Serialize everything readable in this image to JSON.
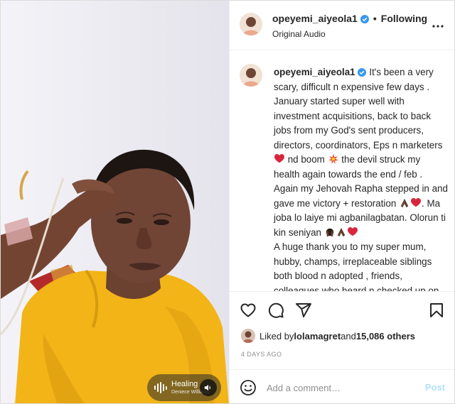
{
  "header": {
    "username": "opeyemi_aiyeola1",
    "separator": "•",
    "follow_label": "Following",
    "audio_label": "Original Audio"
  },
  "caption": {
    "username": "opeyemi_aiyeola1",
    "seg1": " It's been a very scary, difficult n expensive few days . January started super well with investment acquisitions, back to back jobs from my God's sent producers, directors, coordinators, Eps n marketers ",
    "seg2": " nd boom ",
    "seg3": " the devil struck my health again towards the end / feb . Again my Jehovah Rapha stepped in and gave me victory + restoration ",
    "seg4": ". Ma joba lo laiye mi agbanilagbatan. Olorun ti kin seniyan ",
    "seg5": "A huge thank you to my super mum, hubby, champs, irreplaceable siblings both blood n adopted , friends, colleagues who heard n checked up on me and to everyone who will continue to remember me in their prayers as I journey thru this difficult and uncomfortable season"
  },
  "likes": {
    "prefix": "Liked by ",
    "user": "lolamagret",
    "middle": " and ",
    "count": "15,086 others"
  },
  "timestamp": "4 DAYS AGO",
  "comment": {
    "placeholder": "Add a comment…",
    "post_label": "Post"
  },
  "audio": {
    "title": "Healing",
    "artist": "Deniece Williams"
  },
  "icons": {
    "like": "heart-icon",
    "comment": "comment-icon",
    "share": "share-icon",
    "save": "bookmark-icon",
    "more": "more-options-icon",
    "emoji": "emoji-icon",
    "verified": "verified-badge-icon",
    "mute": "volume-icon"
  },
  "colors": {
    "verified": "#3897f0",
    "post_disabled": "#b2dffc",
    "muted_text": "#8e8e8e",
    "text": "#262626"
  }
}
